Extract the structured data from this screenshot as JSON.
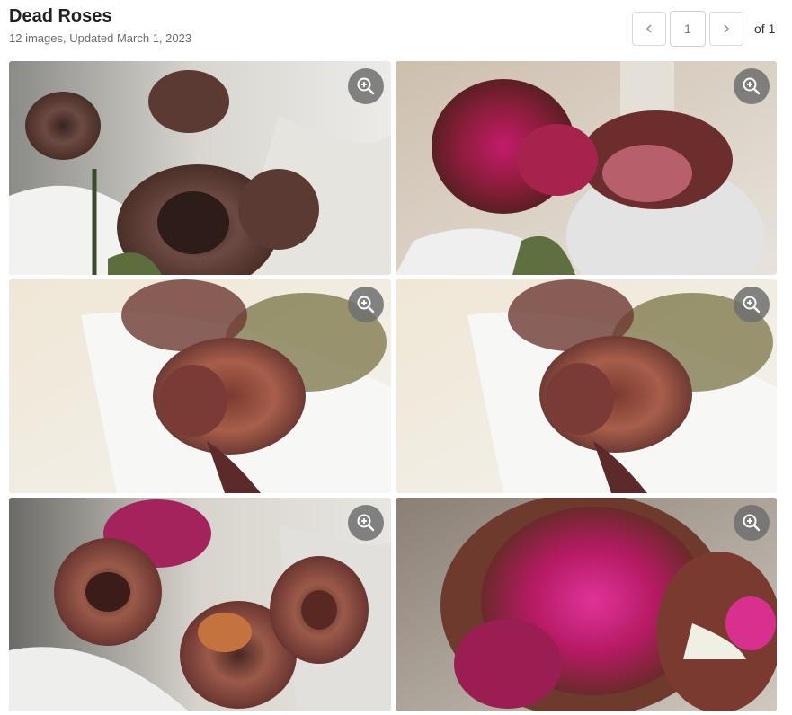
{
  "gallery": {
    "title": "Dead Roses",
    "subtitle": "12 images, Updated March 1, 2023"
  },
  "pagination": {
    "current_page": "1",
    "of_label": "of 1",
    "prev_icon": "chevron-left-icon",
    "next_icon": "chevron-right-icon"
  },
  "tiles": [
    {
      "icon": "zoom-in-icon"
    },
    {
      "icon": "zoom-in-icon"
    },
    {
      "icon": "zoom-in-icon"
    },
    {
      "icon": "zoom-in-icon"
    },
    {
      "icon": "zoom-in-icon"
    },
    {
      "icon": "zoom-in-icon"
    }
  ],
  "colors": {
    "title_text": "#212121",
    "subtitle_text": "#6e6e6e",
    "zoom_button": "#6e6e6e",
    "pager_border": "#d9d9d9"
  }
}
